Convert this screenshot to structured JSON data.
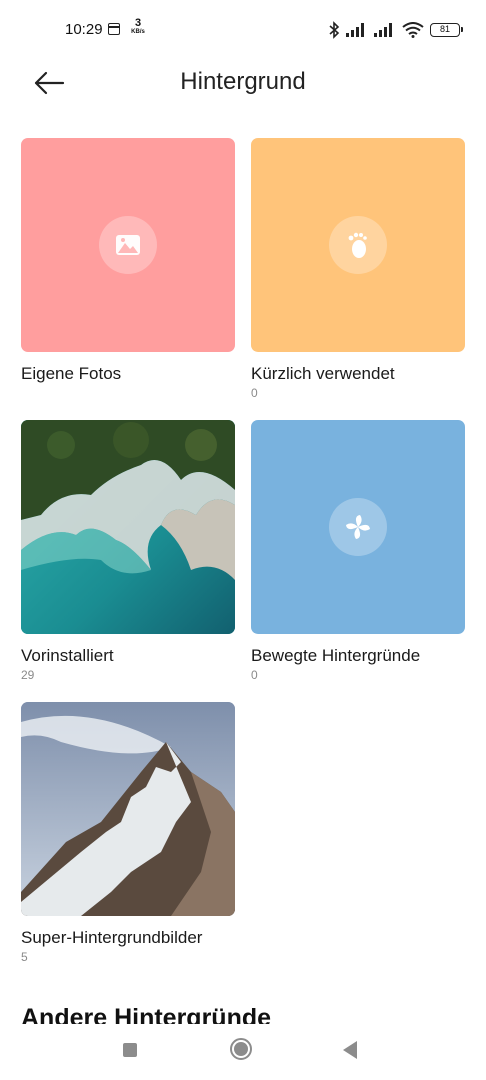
{
  "status_bar": {
    "time": "10:29",
    "net_speed_value": "3",
    "net_speed_unit": "KB/s",
    "battery": "81"
  },
  "header": {
    "title": "Hintergrund",
    "back_icon": "arrow-left-icon"
  },
  "tiles": [
    {
      "label": "Eigene Fotos",
      "count": "",
      "color": "#FF9E9E",
      "icon": "image-icon"
    },
    {
      "label": "Kürzlich verwendet",
      "count": "0",
      "color": "#FFC47A",
      "icon": "footprint-icon"
    },
    {
      "label": "Vorinstalliert",
      "count": "29",
      "icon": "coast-photo"
    },
    {
      "label": "Bewegte Hintergründe",
      "count": "0",
      "color": "#79B2DE",
      "icon": "pinwheel-icon"
    },
    {
      "label": "Super-Hintergrundbilder",
      "count": "5",
      "icon": "mountain-photo"
    }
  ],
  "section": {
    "title": "Andere Hintergründe"
  },
  "nav_bar": {
    "recents_icon": "square-icon",
    "home_icon": "circle-icon",
    "back_icon": "triangle-back-icon"
  }
}
